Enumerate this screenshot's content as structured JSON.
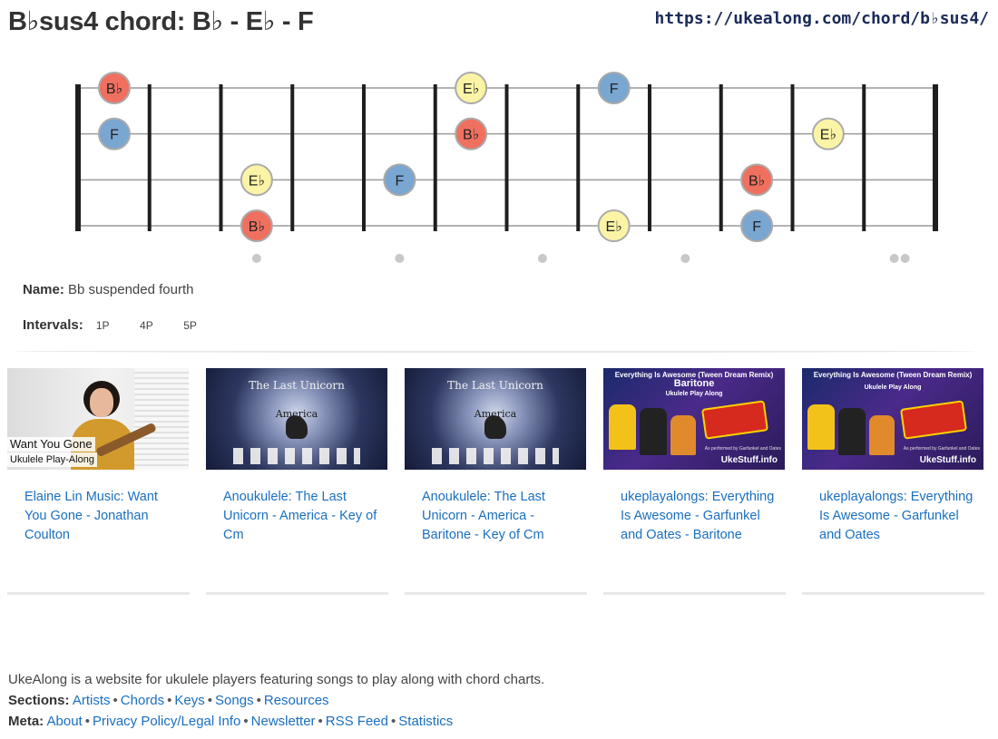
{
  "header": {
    "title": "B♭sus4 chord: B♭ - E♭ - F",
    "url": "https://ukealong.com/chord/b♭sus4/"
  },
  "fretboard": {
    "notes": [
      {
        "label": "B♭",
        "color": "#f07060",
        "string": 0,
        "fret": 0
      },
      {
        "label": "E♭",
        "color": "#fbf4a6",
        "string": 0,
        "fret": 5
      },
      {
        "label": "F",
        "color": "#7aa6d2",
        "string": 0,
        "fret": 7
      },
      {
        "label": "F",
        "color": "#7aa6d2",
        "string": 1,
        "fret": 0
      },
      {
        "label": "B♭",
        "color": "#f07060",
        "string": 1,
        "fret": 5
      },
      {
        "label": "E♭",
        "color": "#fbf4a6",
        "string": 1,
        "fret": 10
      },
      {
        "label": "E♭",
        "color": "#fbf4a6",
        "string": 2,
        "fret": 2
      },
      {
        "label": "F",
        "color": "#7aa6d2",
        "string": 2,
        "fret": 4
      },
      {
        "label": "B♭",
        "color": "#f07060",
        "string": 2,
        "fret": 9
      },
      {
        "label": "B♭",
        "color": "#f07060",
        "string": 3,
        "fret": 2
      },
      {
        "label": "E♭",
        "color": "#fbf4a6",
        "string": 3,
        "fret": 7
      },
      {
        "label": "F",
        "color": "#7aa6d2",
        "string": 3,
        "fret": 9
      }
    ],
    "fret_markers": [
      2,
      4,
      6,
      8,
      11
    ]
  },
  "chord_info": {
    "name_label": "Name:",
    "name_value": "Bb suspended fourth",
    "intervals_label": "Intervals:",
    "intervals": [
      "1P",
      "4P",
      "5P"
    ]
  },
  "videos": [
    {
      "title": "Elaine Lin Music: Want You Gone - Jonathan Coulton",
      "thumb_caption_1": "Want You Gone",
      "thumb_caption_2": "Ukulele Play-Along"
    },
    {
      "title": "Anoukulele: The Last Unicorn - America - Key of Cm",
      "thumb_title": "The Last Unicorn",
      "thumb_sub": "America"
    },
    {
      "title": "Anoukulele: The Last Unicorn - America - Baritone - Key of Cm",
      "thumb_title": "The Last Unicorn",
      "thumb_sub": "America"
    },
    {
      "title": "ukeplayalongs: Everything Is Awesome - Garfunkel and Oates - Baritone",
      "thumb_top": "Everything Is Awesome (Tween Dream Remix)",
      "thumb_big": "Baritone",
      "thumb_small": "Ukulele Play Along",
      "thumb_credit": "As performed by Garfunkel and Oates",
      "thumb_brand": "UkeStuff.info"
    },
    {
      "title": "ukeplayalongs: Everything Is Awesome - Garfunkel and Oates",
      "thumb_top": "Everything Is Awesome (Tween Dream Remix)",
      "thumb_small": "Ukulele Play Along",
      "thumb_credit": "As performed by Garfunkel and Oates",
      "thumb_brand": "UkeStuff.info"
    }
  ],
  "footer": {
    "description": "UkeAlong is a website for ukulele players featuring songs to play along with chord charts.",
    "sections_label": "Sections:",
    "sections": [
      "Artists",
      "Chords",
      "Keys",
      "Songs",
      "Resources"
    ],
    "meta_label": "Meta:",
    "meta": [
      "About",
      "Privacy Policy/Legal Info",
      "Newsletter",
      "RSS Feed",
      "Statistics"
    ]
  }
}
